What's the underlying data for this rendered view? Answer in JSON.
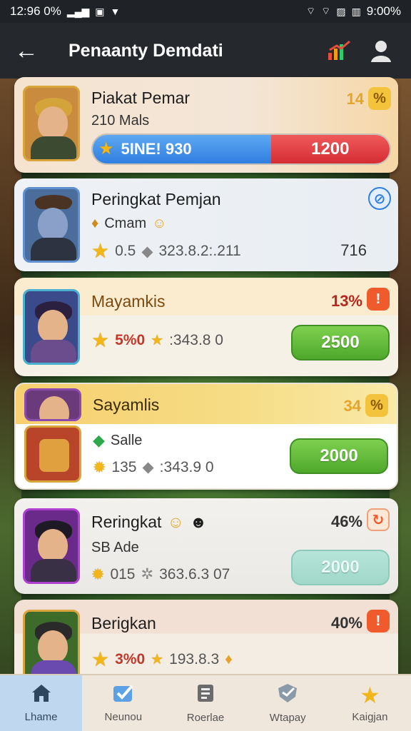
{
  "status_bar": {
    "time": "12:96 0%",
    "right_text": "9:00%"
  },
  "app_bar": {
    "title": "Penaanty Demdati"
  },
  "cards": [
    {
      "name": "Piakat Pemar",
      "subtitle": "210 Mals",
      "percent": "14",
      "badge": "%",
      "bar_left_label": "5INE! 930",
      "bar_right_value": "1200",
      "bar_fill_fraction": 0.6
    },
    {
      "name": "Peringkat Pemjan",
      "subtitle": "Cmam",
      "stat_a": "0.5",
      "stat_b": "323.8.2:.211",
      "value": "716"
    },
    {
      "name": "Mayamkis",
      "percent": "13%",
      "stat_a": "5%0",
      "stat_b": ":343.8 0",
      "button": "2500"
    },
    {
      "name": "Sayamlis",
      "percent": "34",
      "badge": "%",
      "subtitle": "Salle",
      "stat_a": "135",
      "stat_b": ":343.9 0",
      "button": "2000"
    },
    {
      "name": "Reringkat",
      "percent": "46%",
      "subtitle": "SB Ade",
      "stat_a": "015",
      "stat_b": "363.6.3 07",
      "button": "2000"
    },
    {
      "name": "Berigkan",
      "percent": "40%",
      "stat_a": "3%0",
      "stat_b": "193.8.3"
    }
  ],
  "bottom_nav": [
    {
      "label": "Lhame",
      "icon": "home-icon"
    },
    {
      "label": "Neunou",
      "icon": "check-icon"
    },
    {
      "label": "Roerlae",
      "icon": "document-icon"
    },
    {
      "label": "Wtapay",
      "icon": "shield-icon"
    },
    {
      "label": "Kaigjan",
      "icon": "star-icon"
    }
  ],
  "colors": {
    "accent_green": "#4ea82c",
    "accent_blue": "#2f7ee0",
    "accent_red": "#d42d33",
    "gold": "#f2b51a"
  }
}
